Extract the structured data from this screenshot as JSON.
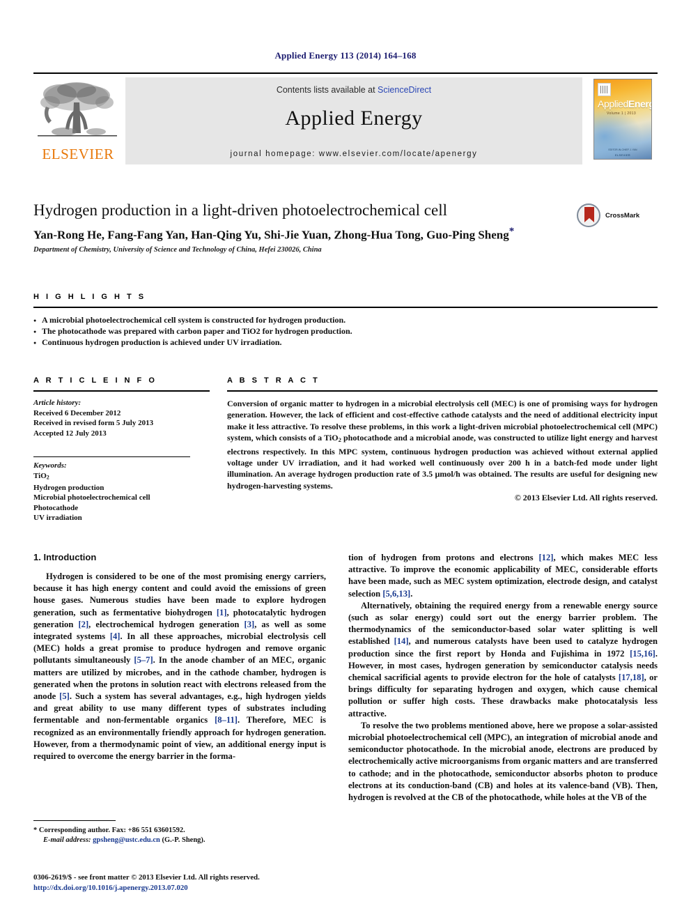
{
  "running_head": "Applied Energy 113 (2014) 164–168",
  "masthead": {
    "publisher_name": "ELSEVIER",
    "publisher_logo_icon": "elsevier-tree-icon",
    "contents_prefix": "Contents lists available at ",
    "contents_link": "ScienceDirect",
    "journal_name": "Applied Energy",
    "homepage": "journal homepage: www.elsevier.com/locate/apenergy",
    "cover": {
      "title_light": "Applied",
      "title_bold": "Energy",
      "subtitle": "Volume 1 | 2013",
      "footer_top": "EDITOR-IN-CHIEF  J. YAN",
      "footer_bottom": "ELSEVIER"
    }
  },
  "article": {
    "title": "Hydrogen production in a light-driven photoelectrochemical cell",
    "authors": "Yan-Rong He, Fang-Fang Yan, Han-Qing Yu, Shi-Jie Yuan, Zhong-Hua Tong, Guo-Ping Sheng",
    "corresponding_marker": "*",
    "affiliation": "Department of Chemistry, University of Science and Technology of China, Hefei 230026, China",
    "crossmark_label": "CrossMark"
  },
  "highlights": {
    "heading": "H I G H L I G H T S",
    "items": [
      "A microbial photoelectrochemical cell system is constructed for hydrogen production.",
      "The photocathode was prepared with carbon paper and TiO2 for hydrogen production.",
      "Continuous hydrogen production is achieved under UV irradiation."
    ]
  },
  "article_info": {
    "heading": "A R T I C L E    I N F O",
    "history_label": "Article history:",
    "history": [
      "Received 6 December 2012",
      "Received in revised form 5 July 2013",
      "Accepted 12 July 2013"
    ],
    "keywords_label": "Keywords:",
    "keywords": [
      "TiO2",
      "Hydrogen production",
      "Microbial photoelectrochemical cell",
      "Photocathode",
      "UV irradiation"
    ]
  },
  "abstract": {
    "heading": "A B S T R A C T",
    "text": "Conversion of organic matter to hydrogen in a microbial electrolysis cell (MEC) is one of promising ways for hydrogen generation. However, the lack of efficient and cost-effective cathode catalysts and the need of additional electricity input make it less attractive. To resolve these problems, in this work a light-driven microbial photoelectrochemical cell (MPC) system, which consists of a TiO2 photocathode and a microbial anode, was constructed to utilize light energy and harvest electrons respectively. In this MPC system, continuous hydrogen production was achieved without external applied voltage under UV irradiation, and it had worked well continuously over 200 h in a batch-fed mode under light illumination. An average hydrogen production rate of 3.5 µmol/h was obtained. The results are useful for designing new hydrogen-harvesting systems.",
    "copyright": "© 2013 Elsevier Ltd. All rights reserved."
  },
  "introduction": {
    "heading": "1. Introduction",
    "left_paragraph_1": "Hydrogen is considered to be one of the most promising energy carriers, because it has high energy content and could avoid the emissions of green house gases. Numerous studies have been made to explore hydrogen generation, such as fermentative biohydrogen [1], photocatalytic hydrogen generation [2], electrochemical hydrogen generation [3], as well as some integrated systems [4]. In all these approaches, microbial electrolysis cell (MEC) holds a great promise to produce hydrogen and remove organic pollutants simultaneously [5–7]. In the anode chamber of an MEC, organic matters are utilized by microbes, and in the cathode chamber, hydrogen is generated when the protons in solution react with electrons released from the anode [5]. Such a system has several advantages, e.g., high hydrogen yields and great ability to use many different types of substrates including fermentable and non-fermentable organics [8–11]. Therefore, MEC is recognized as an environmentally friendly approach for hydrogen generation. However, from a thermodynamic point of view, an additional energy input is required to overcome the energy barrier in the forma-",
    "right_paragraph_1": "tion of hydrogen from protons and electrons [12], which makes MEC less attractive. To improve the economic applicability of MEC, considerable efforts have been made, such as MEC system optimization, electrode design, and catalyst selection [5,6,13].",
    "right_paragraph_2": "Alternatively, obtaining the required energy from a renewable energy source (such as solar energy) could sort out the energy barrier problem. The thermodynamics of the semiconductor-based solar water splitting is well established [14], and numerous catalysts have been used to catalyze hydrogen production since the first report by Honda and Fujishima in 1972 [15,16]. However, in most cases, hydrogen generation by semiconductor catalysis needs chemical sacrificial agents to provide electron for the hole of catalysts [17,18], or brings difficulty for separating hydrogen and oxygen, which cause chemical pollution or suffer high costs. These drawbacks make photocatalysis less attractive.",
    "right_paragraph_3": "To resolve the two problems mentioned above, here we propose a solar-assisted microbial photoelectrochemical cell (MPC), an integration of microbial anode and semiconductor photocathode. In the microbial anode, electrons are produced by electrochemically active microorganisms from organic matters and are transferred to cathode; and in the photocathode, semiconductor absorbs photon to produce electrons at its conduction-band (CB) and holes at its valence-band (VB). Then, hydrogen is revolved at the CB of the photocathode, while holes at the VB of the"
  },
  "footnote": {
    "marker": "*",
    "corresponding": "Corresponding author. Fax: +86 551 63601592.",
    "email_label": "E-mail address:",
    "email": "gpsheng@ustc.edu.cn",
    "email_owner": "(G.-P. Sheng)."
  },
  "footer": {
    "issn_line": "0306-2619/$ - see front matter © 2013 Elsevier Ltd. All rights reserved.",
    "doi": "http://dx.doi.org/10.1016/j.apenergy.2013.07.020"
  },
  "colors": {
    "elsevier_orange": "#E8780A",
    "link_blue": "#1a3a8f",
    "running_head_navy": "#1a1a6e",
    "band_grey": "#e6e6e6",
    "crossmark_red": "#b5281c"
  }
}
